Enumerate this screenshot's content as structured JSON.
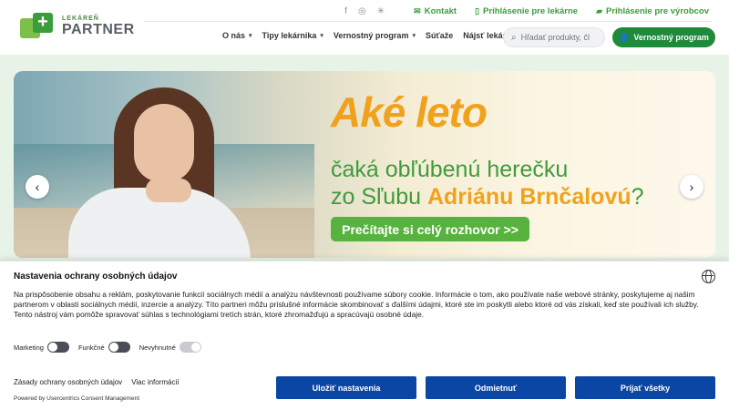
{
  "logo": {
    "small": "LEKÁREŇ",
    "big": "PARTNER",
    "plus": "+"
  },
  "topbar": {
    "social": [
      "f",
      "◎",
      "✳"
    ],
    "links": [
      {
        "icon": "✉",
        "label": "Kontakt"
      },
      {
        "icon": "▯",
        "label": "Prihlásenie pre lekárne"
      },
      {
        "icon": "▰",
        "label": "Prihlásenie pre výrobcov"
      }
    ]
  },
  "nav": {
    "items": [
      {
        "label": "O nás",
        "caret": "▾"
      },
      {
        "label": "Tipy lekárnika",
        "caret": "▾"
      },
      {
        "label": "Vernostný program",
        "caret": "▾"
      },
      {
        "label": "Súťaže",
        "caret": ""
      },
      {
        "label": "Nájsť lekáreň",
        "caret": ""
      }
    ]
  },
  "search": {
    "placeholder": "Hľadať produkty, čl",
    "icon": "⌕"
  },
  "loyalty_button": {
    "icon": "👤",
    "label": "Vernostný program"
  },
  "hero": {
    "headline": "Aké leto",
    "line1": "čaká obľúbenú herečku",
    "line2_prefix": "zo Sľubu ",
    "line2_highlight": "Adriánu Brnčalovú",
    "line2_suffix": "?",
    "cta": "Prečítajte si celý rozhovor >>",
    "prev": "‹",
    "next": "›"
  },
  "consent": {
    "title": "Nastavenia ochrany osobných údajov",
    "text1": "Na prispôsobenie obsahu a reklám, poskytovanie funkcií sociálnych médií a analýzu návštevnosti používame súbory cookie. Informácie o tom, ako používate naše webové stránky, poskytujeme aj našim partnerom v oblasti sociálnych médií, inzercie a analýzy. Títo partneri môžu príslušné informácie skombinovať s ďalšími údajmi, ktoré ste im poskytli alebo ktoré od vás získali, keď ste používali ich služby.",
    "text2": "Tento nástroj vám pomôže spravovať súhlas s technológiami tretích strán, ktoré zhromažďujú a spracúvajú osobné údaje.",
    "toggles": [
      {
        "label": "Marketing"
      },
      {
        "label": "Funkčné"
      },
      {
        "label": "Nevyhnutné"
      }
    ],
    "links": [
      "Zásady ochrany osobných údajov",
      "Viac informácií"
    ],
    "powered": "Powered by Usercentrics Consent Management",
    "buttons": {
      "save": "Uložiť nastavenia",
      "deny": "Odmietnuť",
      "accept": "Prijať všetky"
    }
  }
}
